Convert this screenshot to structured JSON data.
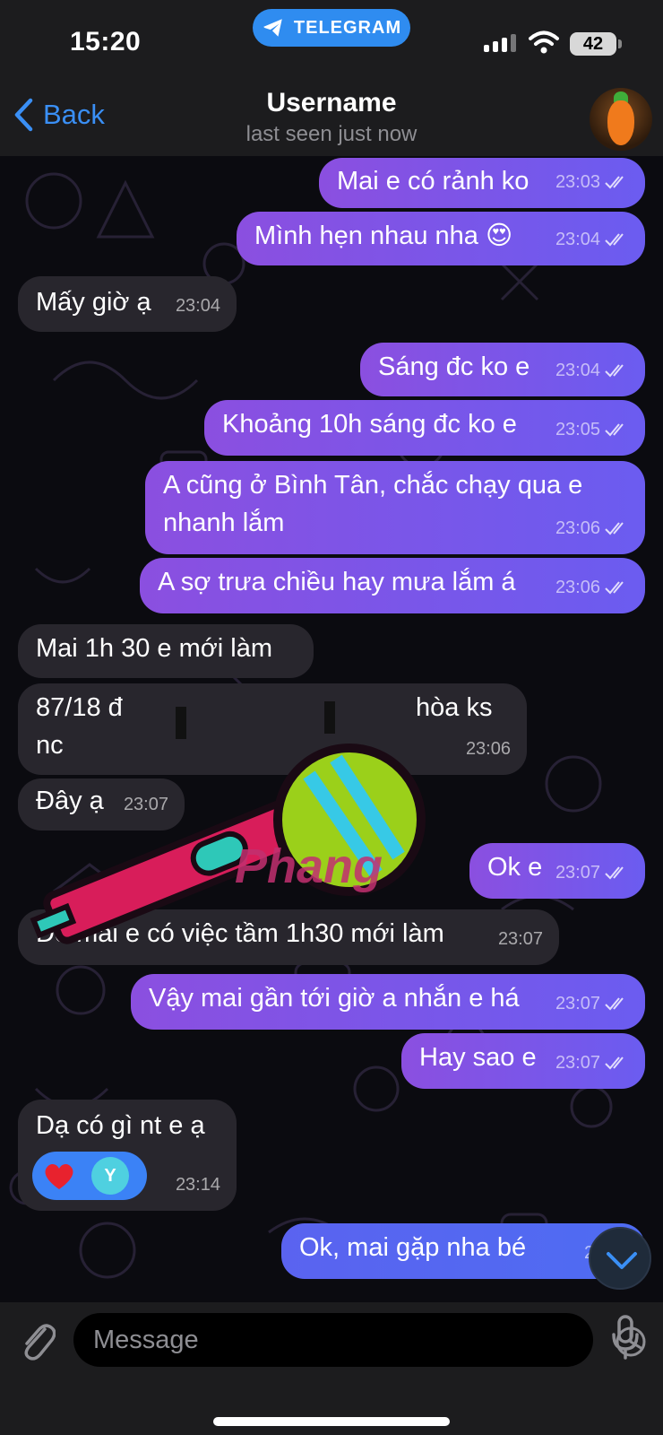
{
  "status_bar": {
    "time": "15:20",
    "app_pill": "TELEGRAM",
    "battery": "42"
  },
  "header": {
    "back_label": "Back",
    "title": "Username",
    "subtitle": "last seen just now"
  },
  "messages": [
    {
      "dir": "out",
      "text": "Mai e có rảnh ko",
      "time": "23:03"
    },
    {
      "dir": "out",
      "text": "Mình hẹn nhau nha 😍",
      "time": "23:04"
    },
    {
      "dir": "in",
      "text": "Mấy giờ ạ",
      "time": "23:04"
    },
    {
      "dir": "out",
      "text": "Sáng đc ko e",
      "time": "23:04"
    },
    {
      "dir": "out",
      "text": "Khoảng 10h sáng đc ko e",
      "time": "23:05"
    },
    {
      "dir": "out",
      "text_line1": "A cũng ở Bình Tân, chắc chạy qua e",
      "text_line2": "nhanh lắm",
      "time": "23:06"
    },
    {
      "dir": "out",
      "text": "A sợ trưa chiều hay mưa lắm á",
      "time": "23:06"
    },
    {
      "dir": "in",
      "text": "Mai 1h 30 e mới làm",
      "time": ""
    },
    {
      "dir": "in",
      "text_line1": "87/18 đ",
      "text_line1_end": "hòa ks",
      "text_line2": "nc",
      "time": "23:06"
    },
    {
      "dir": "in",
      "text": "Đây ạ",
      "time": "23:07"
    },
    {
      "dir": "out",
      "text": "Ok e",
      "time": "23:07"
    },
    {
      "dir": "in",
      "text": "Do mai e có việc tầm 1h30 mới làm",
      "time": "23:07"
    },
    {
      "dir": "out",
      "text": "Vậy mai gần tới giờ a nhắn e há",
      "time": "23:07"
    },
    {
      "dir": "out",
      "text": "Hay sao e",
      "time": "23:07"
    },
    {
      "dir": "in",
      "text": "Dạ có gì nt e ạ",
      "time": "23:14",
      "reaction_initial": "Y"
    },
    {
      "dir": "out",
      "text": "Ok, mai gặp nha bé",
      "time": "23:14"
    }
  ],
  "watermark_text": "Phang",
  "composer": {
    "placeholder": "Message"
  },
  "colors": {
    "outgoing_bubble": "#7b55ea",
    "incoming_bubble": "#28262d",
    "accent": "#3a8ff5"
  }
}
